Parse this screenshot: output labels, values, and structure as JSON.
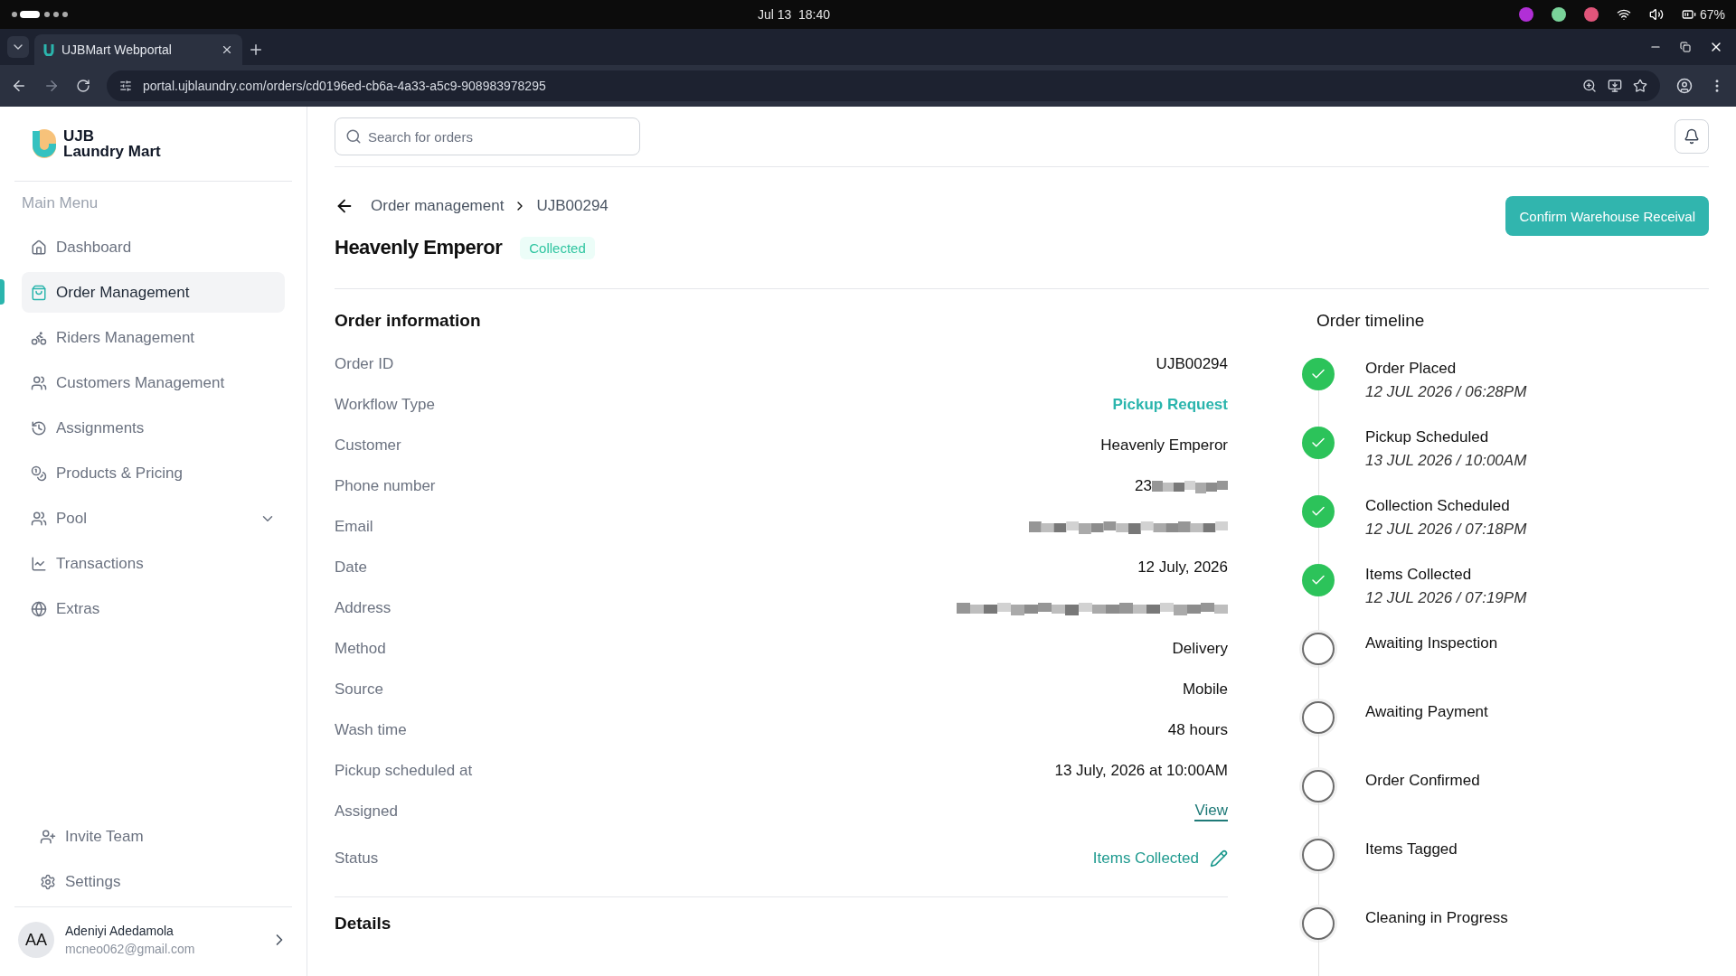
{
  "system_bar": {
    "date": "Jul 13",
    "time": "18:40",
    "battery": "67%"
  },
  "browser": {
    "tab_title": "UJBMart Webportal",
    "url": "portal.ujblaundry.com/orders/cd0196ed-cb6a-4a33-a5c9-908983978295"
  },
  "sidebar": {
    "logo_line1": "UJB",
    "logo_line2": "Laundry Mart",
    "section": "Main Menu",
    "items": [
      {
        "label": "Dashboard",
        "selected": false,
        "expandable": false
      },
      {
        "label": "Order Management",
        "selected": true,
        "expandable": false
      },
      {
        "label": "Riders Management",
        "selected": false,
        "expandable": false
      },
      {
        "label": "Customers Management",
        "selected": false,
        "expandable": false
      },
      {
        "label": "Assignments",
        "selected": false,
        "expandable": false
      },
      {
        "label": "Products & Pricing",
        "selected": false,
        "expandable": false
      },
      {
        "label": "Pool",
        "selected": false,
        "expandable": true
      },
      {
        "label": "Transactions",
        "selected": false,
        "expandable": false
      },
      {
        "label": "Extras",
        "selected": false,
        "expandable": false
      }
    ],
    "footer_items": [
      "Invite Team",
      "Settings"
    ],
    "user": {
      "initials": "AA",
      "name": "Adeniyi Adedamola",
      "email": "mcneo062@gmail.com"
    }
  },
  "search": {
    "placeholder": "Search for orders"
  },
  "breadcrumb": [
    "Order management",
    "UJB00294"
  ],
  "header": {
    "title": "Heavenly Emperor",
    "badge": "Collected",
    "action": "Confirm Warehouse Receival"
  },
  "order_information": {
    "title": "Order information",
    "rows": [
      {
        "label": "Order ID",
        "kind": "text",
        "value": "UJB00294"
      },
      {
        "label": "Workflow Type",
        "kind": "accent",
        "value": "Pickup Request"
      },
      {
        "label": "Customer",
        "kind": "text",
        "value": "Heavenly Emperor"
      },
      {
        "label": "Phone number",
        "kind": "partly-hidden",
        "value": "23"
      },
      {
        "label": "Email",
        "kind": "hidden"
      },
      {
        "label": "Date",
        "kind": "text",
        "value": "12 July, 2026"
      },
      {
        "label": "Address",
        "kind": "hidden"
      },
      {
        "label": "Method",
        "kind": "text",
        "value": "Delivery"
      },
      {
        "label": "Source",
        "kind": "text",
        "value": "Mobile"
      },
      {
        "label": "Wash time",
        "kind": "text",
        "value": "48 hours"
      },
      {
        "label": "Pickup scheduled at",
        "kind": "text",
        "value": "13 July, 2026 at 10:00AM"
      },
      {
        "label": "Assigned",
        "kind": "link",
        "value": "View"
      },
      {
        "label": "Status",
        "kind": "editable",
        "value": "Items Collected"
      }
    ]
  },
  "details_title": "Details",
  "timeline": {
    "title": "Order timeline",
    "steps": [
      {
        "label": "Order Placed",
        "time": "12 JUL 2026 / 06:28PM",
        "done": true
      },
      {
        "label": "Pickup Scheduled",
        "time": "13 JUL 2026 / 10:00AM",
        "done": true
      },
      {
        "label": "Collection Scheduled",
        "time": "12 JUL 2026 / 07:18PM",
        "done": true
      },
      {
        "label": "Items Collected",
        "time": "12 JUL 2026 / 07:19PM",
        "done": true
      },
      {
        "label": "Awaiting Inspection",
        "done": false
      },
      {
        "label": "Awaiting Payment",
        "done": false
      },
      {
        "label": "Order Confirmed",
        "done": false
      },
      {
        "label": "Items Tagged",
        "done": false
      },
      {
        "label": "Cleaning in Progress",
        "done": false
      }
    ]
  }
}
